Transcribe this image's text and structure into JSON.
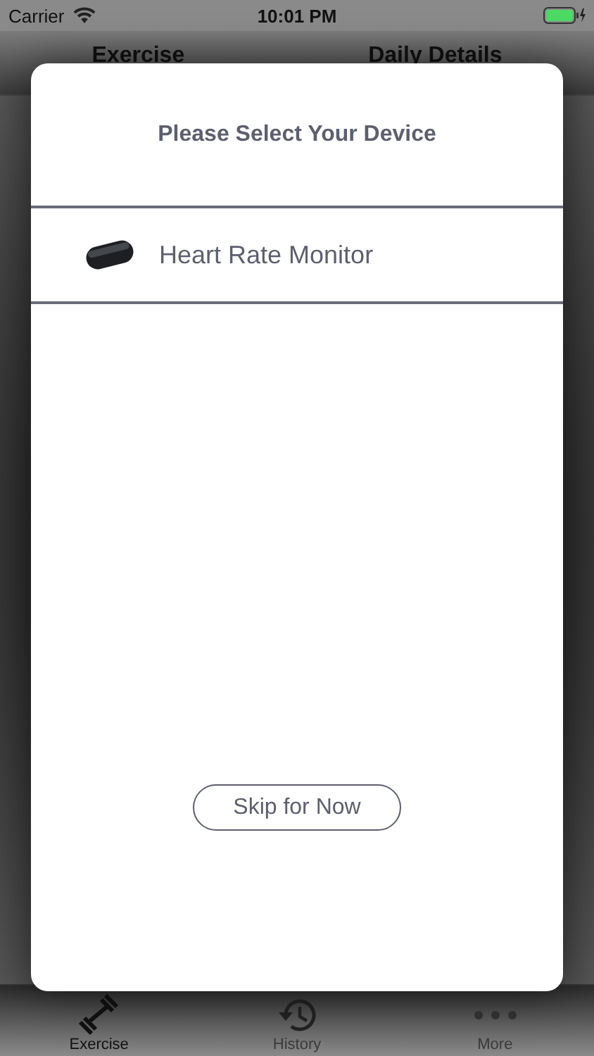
{
  "status_bar": {
    "carrier": "Carrier",
    "time": "10:01 PM"
  },
  "header_tabs": [
    {
      "label": "Exercise"
    },
    {
      "label": "Daily Details"
    }
  ],
  "dialog": {
    "title": "Please Select Your Device",
    "devices": [
      {
        "name": "Heart Rate Monitor"
      }
    ],
    "skip_button": "Skip for Now"
  },
  "tab_bar": [
    {
      "label": "Exercise",
      "kind": "dumbbell",
      "selected": true
    },
    {
      "label": "History",
      "kind": "history",
      "selected": false
    },
    {
      "label": "More",
      "kind": "more",
      "selected": false
    }
  ]
}
